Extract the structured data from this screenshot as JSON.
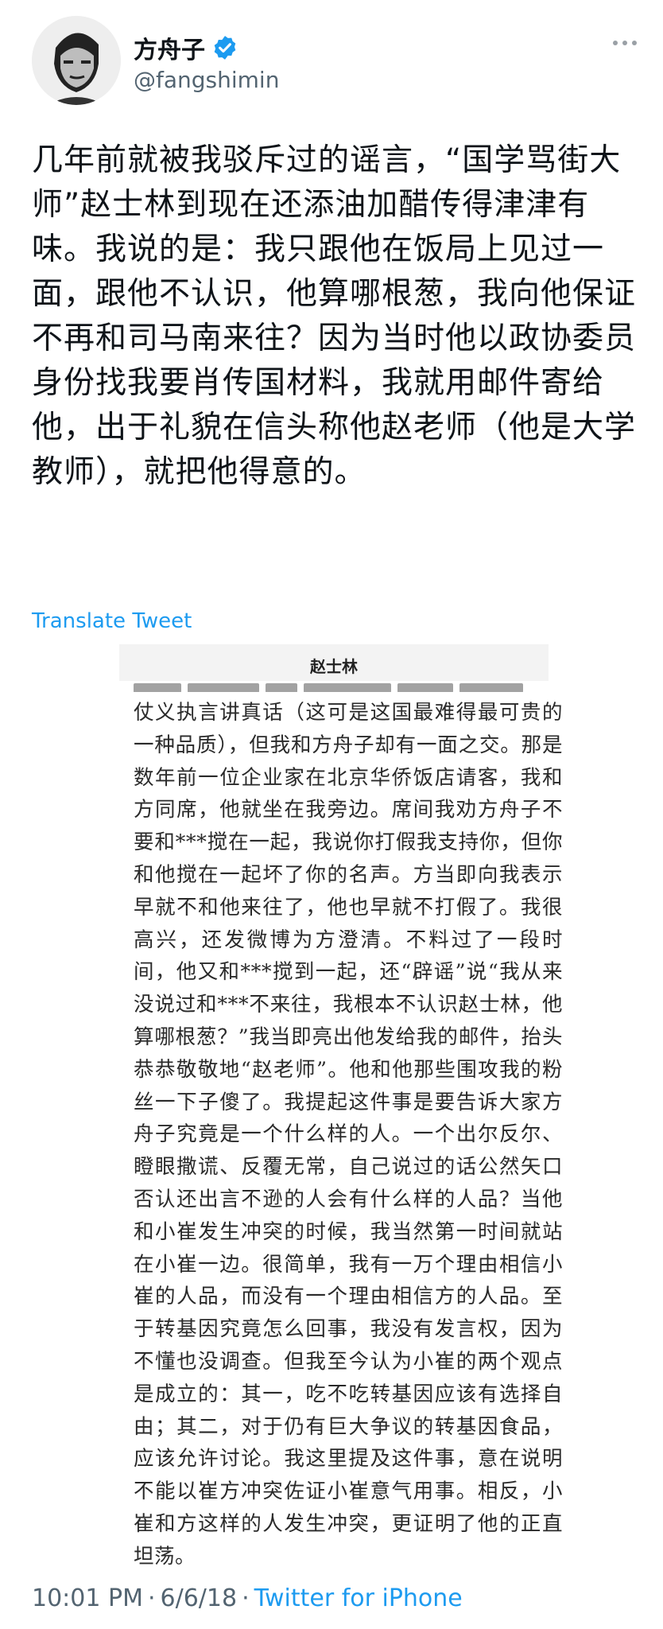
{
  "author": {
    "name": "方舟子",
    "handle": "@fangshimin"
  },
  "tweet": {
    "text": "几年前就被我驳斥过的谣言，“国学骂街大师”赵士林到现在还添油加醋传得津津有味。我说的是：我只跟他在饭局上见过一面，跟他不认识，他算哪根葱，我向他保证不再和司马南来往？因为当时他以政协委员身份找我要肖传国材料，我就用邮件寄给他，出于礼貌在信头称他赵老师（他是大学教师），就把他得意的。",
    "translate_label": "Translate Tweet"
  },
  "media": {
    "title": "赵士林",
    "article": "仗义执言讲真话（这可是这国最难得最可贵的一种品质），但我和方舟子却有一面之交。那是数年前一位企业家在北京华侨饭店请客，我和方同席，他就坐在我旁边。席间我劝方舟子不要和***搅在一起，我说你打假我支持你，但你和他搅在一起坏了你的名声。方当即向我表示早就不和他来往了，他也早就不打假了。我很高兴，还发微博为方澄清。不料过了一段时间，他又和***搅到一起，还“辟谣”说“我从来没说过和***不来往，我根本不认识赵士林，他算哪根葱？”我当即亮出他发给我的邮件，抬头恭恭敬敬地“赵老师”。他和他那些围攻我的粉丝一下子傻了。我提起这件事是要告诉大家方舟子究竟是一个什么样的人。一个出尔反尔、瞪眼撒谎、反覆无常，自己说过的话公然矢口否认还出言不逊的人会有什么样的人品？当他和小崔发生冲突的时候，我当然第一时间就站在小崔一边。很简单，我有一万个理由相信小崔的人品，而没有一个理由相信方的人品。至于转基因究竟怎么回事，我没有发言权，因为不懂也没调查。但我至今认为小崔的两个观点是成立的：其一，吃不吃转基因应该有选择自由；其二，对于仍有巨大争议的转基因食品，应该允许讨论。我这里提及这件事，意在说明不能以崔方冲突佐证小崔意气用事。相反，小崔和方这样的人发生冲突，更证明了他的正直坦荡。"
  },
  "footer": {
    "time": "10:01 PM",
    "separator1": "·",
    "date": "6/6/18",
    "separator2": "·",
    "source": "Twitter for iPhone"
  },
  "colors": {
    "accent": "#1d9bf0",
    "secondary_text": "#536471",
    "primary_text": "#0f1419"
  },
  "icons": [
    "verified-badge-icon",
    "more-options-icon"
  ]
}
